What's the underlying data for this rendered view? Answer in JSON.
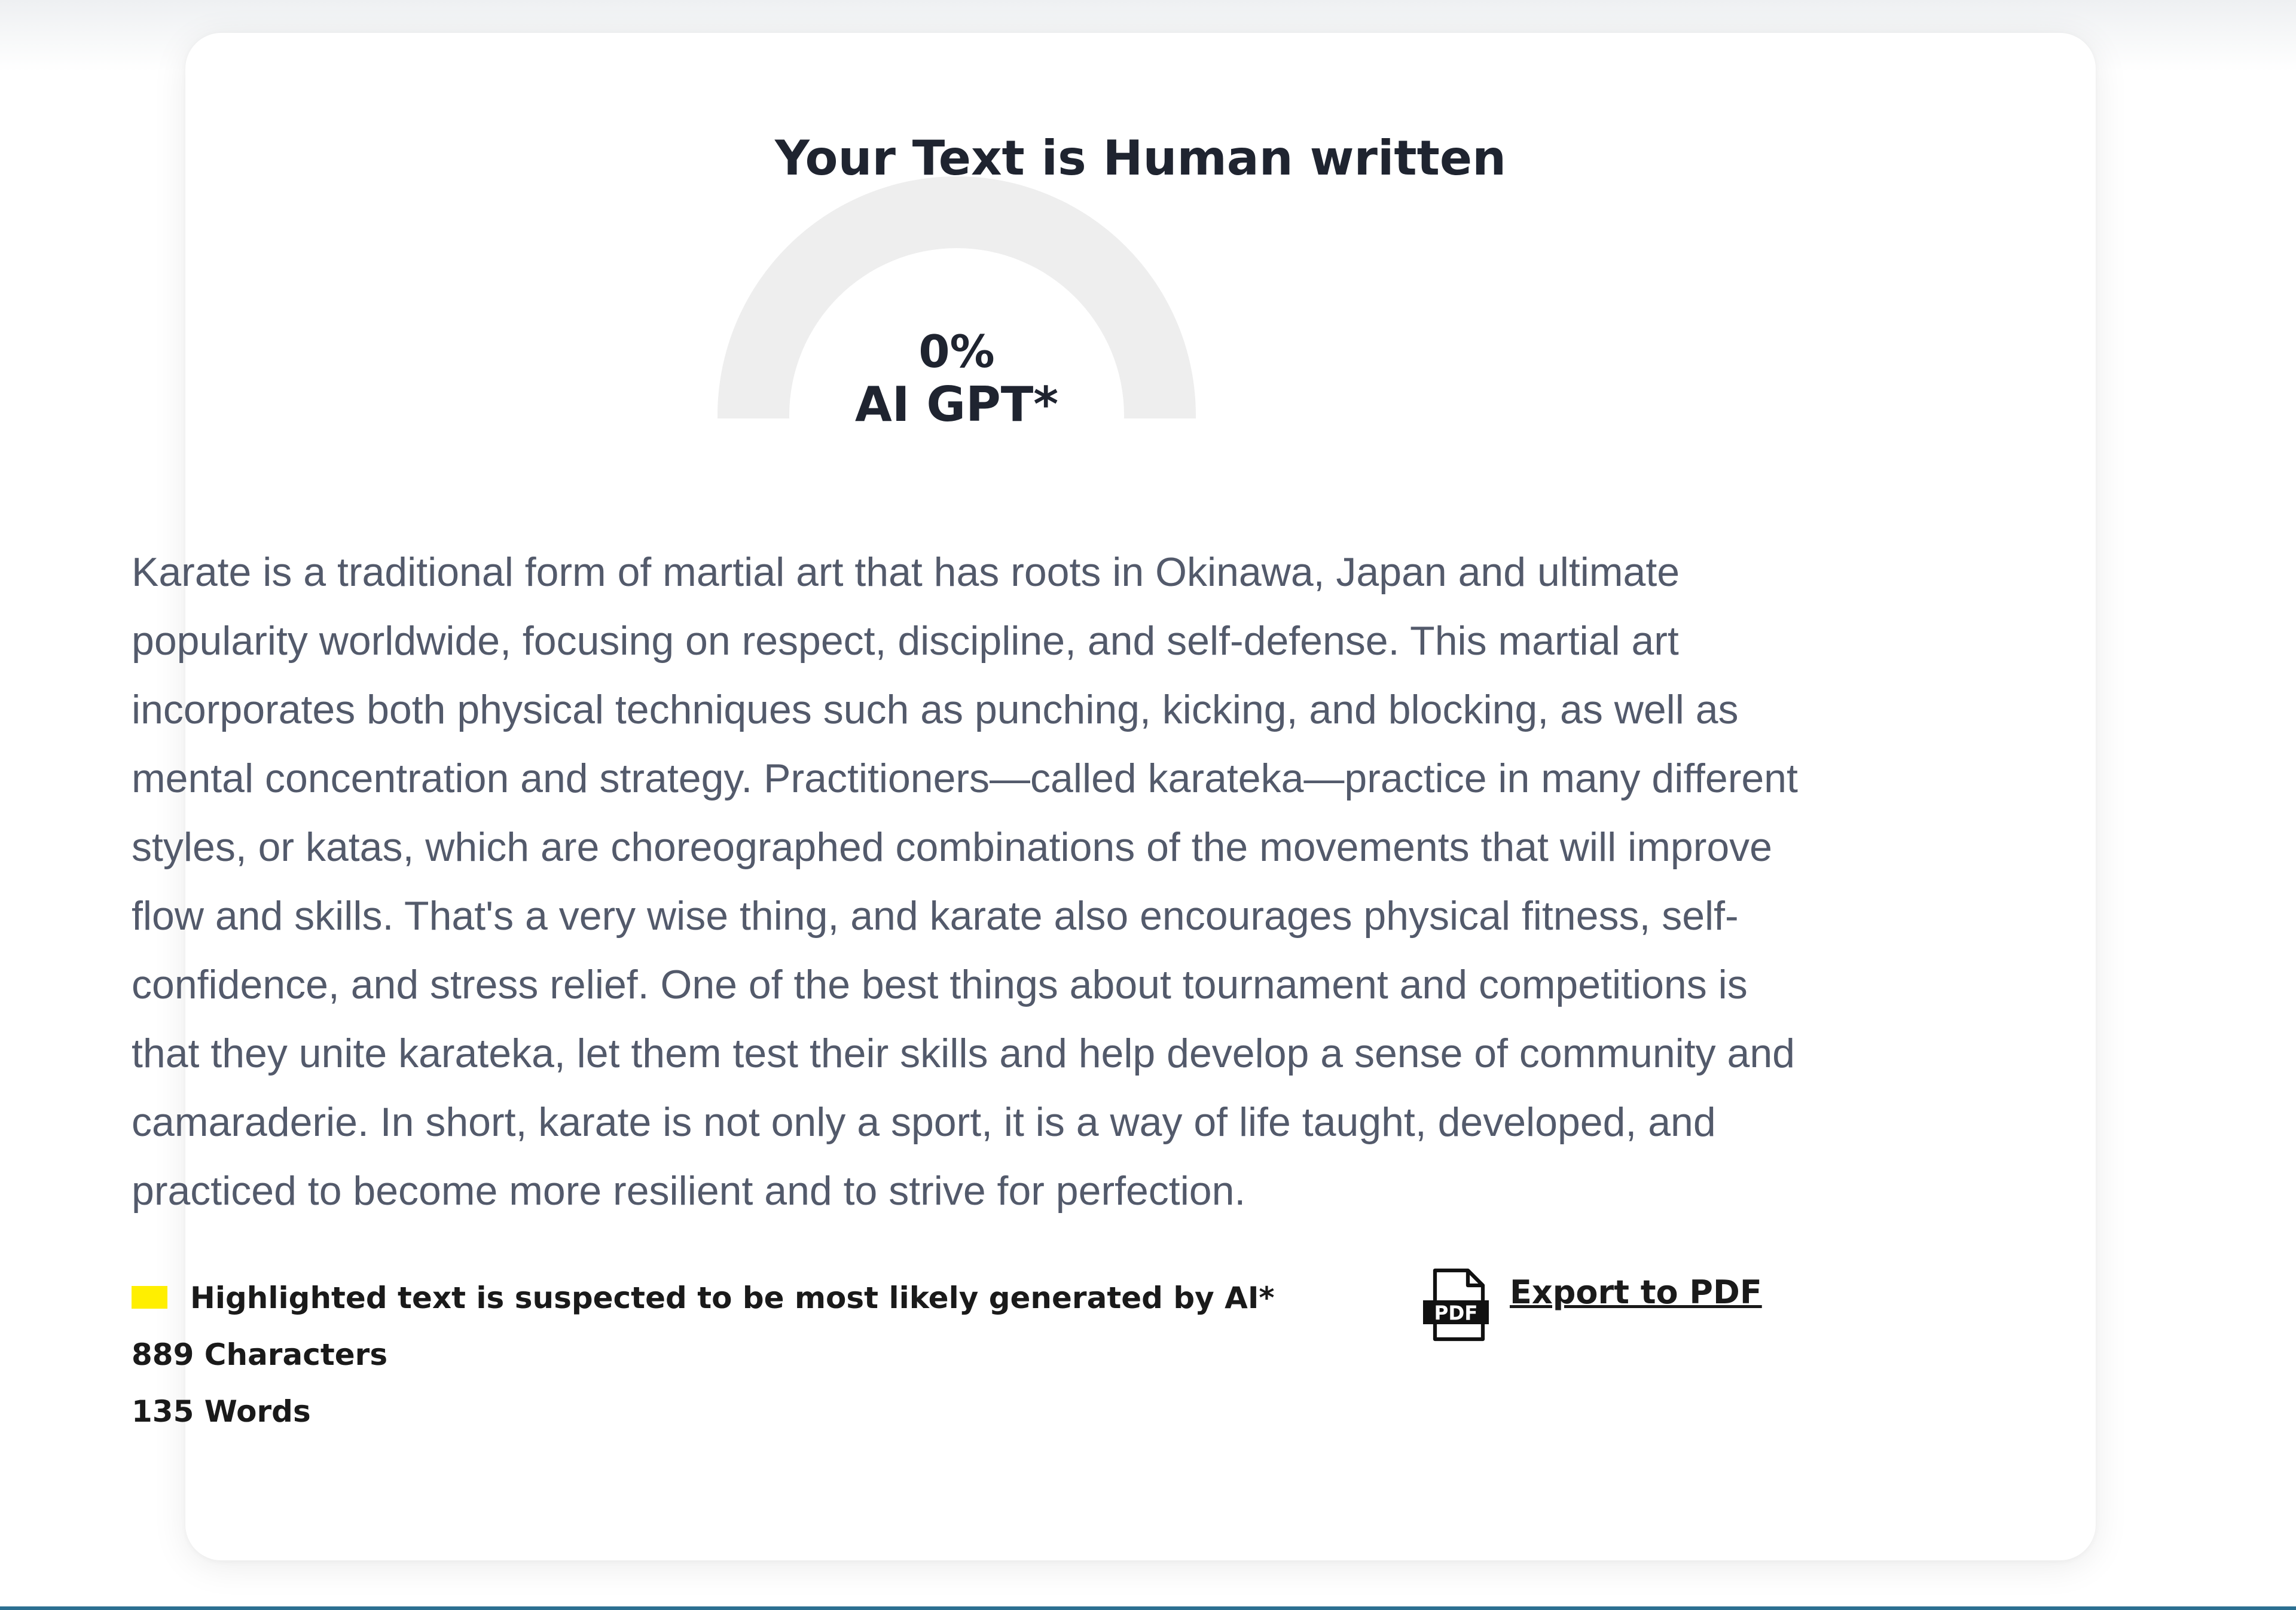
{
  "result": {
    "title": "Your Text is Human written",
    "ai_percent": "0%",
    "ai_fraction": 0,
    "ai_label": "AI GPT*"
  },
  "content": {
    "text": "Karate is a traditional form of martial art that has roots in Okinawa, Japan and ultimate popularity worldwide, focusing on respect, discipline, and self-defense. This martial art incorporates both physical techniques such as punching, kicking, and blocking, as well as mental concentration and strategy. Practitioners—called karateka—practice in many different styles, or katas, which are choreographed combinations of the movements that will improve flow and skills. That's a very wise thing, and karate also encourages physical fitness, self-confidence, and stress relief. One of the best things about tournament and competitions is that they unite karateka, let them test their skills and help develop a sense of community and camaraderie. In short, karate is not only a sport, it is a way of life taught, developed, and practiced to become more resilient and to strive for perfection."
  },
  "meta": {
    "legend": "Highlighted text is suspected to be most likely generated by AI*",
    "characters": "889 Characters",
    "words": "135 Words"
  },
  "export": {
    "label": "Export to PDF",
    "icon": "pdf-file-icon",
    "icon_text": "PDF"
  },
  "colors": {
    "highlight": "#ffef00",
    "gauge_track": "#eeeeee",
    "gauge_fill": "#e8434f",
    "text": "#535a6b",
    "heading": "#1f2430"
  }
}
